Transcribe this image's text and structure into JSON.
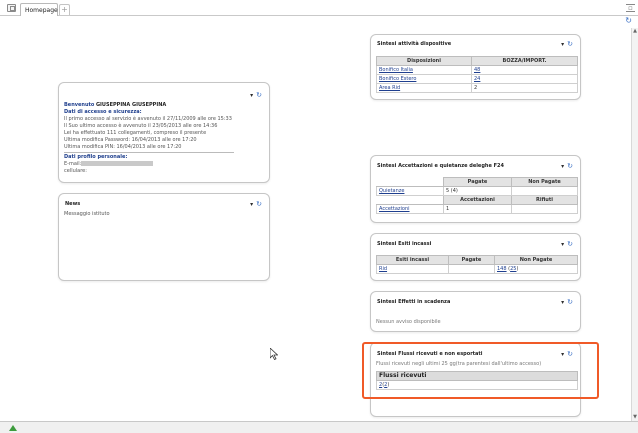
{
  "tabs": {
    "active_label": "Homepage",
    "add_label": "+"
  },
  "welcome": {
    "greeting_label": "Benvenuto",
    "user_name": "GIUSEPPINA GIUSEPPINA",
    "access_heading": "Dati di accesso e sicurezza:",
    "lines": [
      "Il primo accesso al servizio è avvenuto il 27/11/2009 alle ore 15:33",
      "Il Suo ultimo accesso è avvenuto il 23/05/2013 alle ore 14:36",
      "Lei ha effettuato 111 collegamenti, compreso il presente",
      "Ultima modifica Password: 16/04/2013 alle ore 17:20",
      "Ultima modifica PIN: 16/04/2013 alle ore 17:20"
    ],
    "profile_heading": "Dati profilo personale:",
    "email_label": "E-mail:",
    "phone_label": "cellulare:"
  },
  "news": {
    "title": "News",
    "message": "Messaggio istituto"
  },
  "dispositive": {
    "title": "Sintesi attività dispositive",
    "headers": [
      "Disposizioni",
      "BOZZA/IMPORT."
    ],
    "rows": [
      {
        "label": "Bonifico Italia",
        "value": "48"
      },
      {
        "label": "Bonifico Estero",
        "value": "24"
      },
      {
        "label": "Area Rid",
        "value": "2"
      }
    ]
  },
  "f24": {
    "title": "Sintesi Accettazioni e quietanze deleghe F24",
    "headers1": [
      "",
      "Pagate",
      "Non Pagate"
    ],
    "row1": {
      "label": "Quietanze",
      "pagate": "5 (4)",
      "non_pagate": ""
    },
    "headers2": [
      "",
      "Accettazioni",
      "Rifiuti"
    ],
    "row2": {
      "label": "Accettazioni",
      "accettazioni": "1",
      "rifiuti": ""
    }
  },
  "incassi": {
    "title": "Sintesi Esiti incassi",
    "headers": [
      "Esiti incassi",
      "Pagate",
      "Non Pagate"
    ],
    "row": {
      "label": "Rid",
      "pagate": "",
      "non_pagate_link": "148",
      "non_pagate_paren": "25"
    }
  },
  "effetti": {
    "title": "Sintesi Effetti in scadenza",
    "message": "Nessun avviso disponibile"
  },
  "flussi": {
    "title": "Sintesi Flussi ricevuti e non esportati",
    "subtitle": "Flussi ricevuti negli ultimi 25 gg(tra parentesi dall'ultimo accesso)",
    "header": "Flussi ricevuti",
    "value_link": "2",
    "value_paren": "2"
  },
  "colors": {
    "accent_link": "#1f3f8f",
    "highlight": "#f05a28",
    "refresh": "#3a6fc4"
  }
}
